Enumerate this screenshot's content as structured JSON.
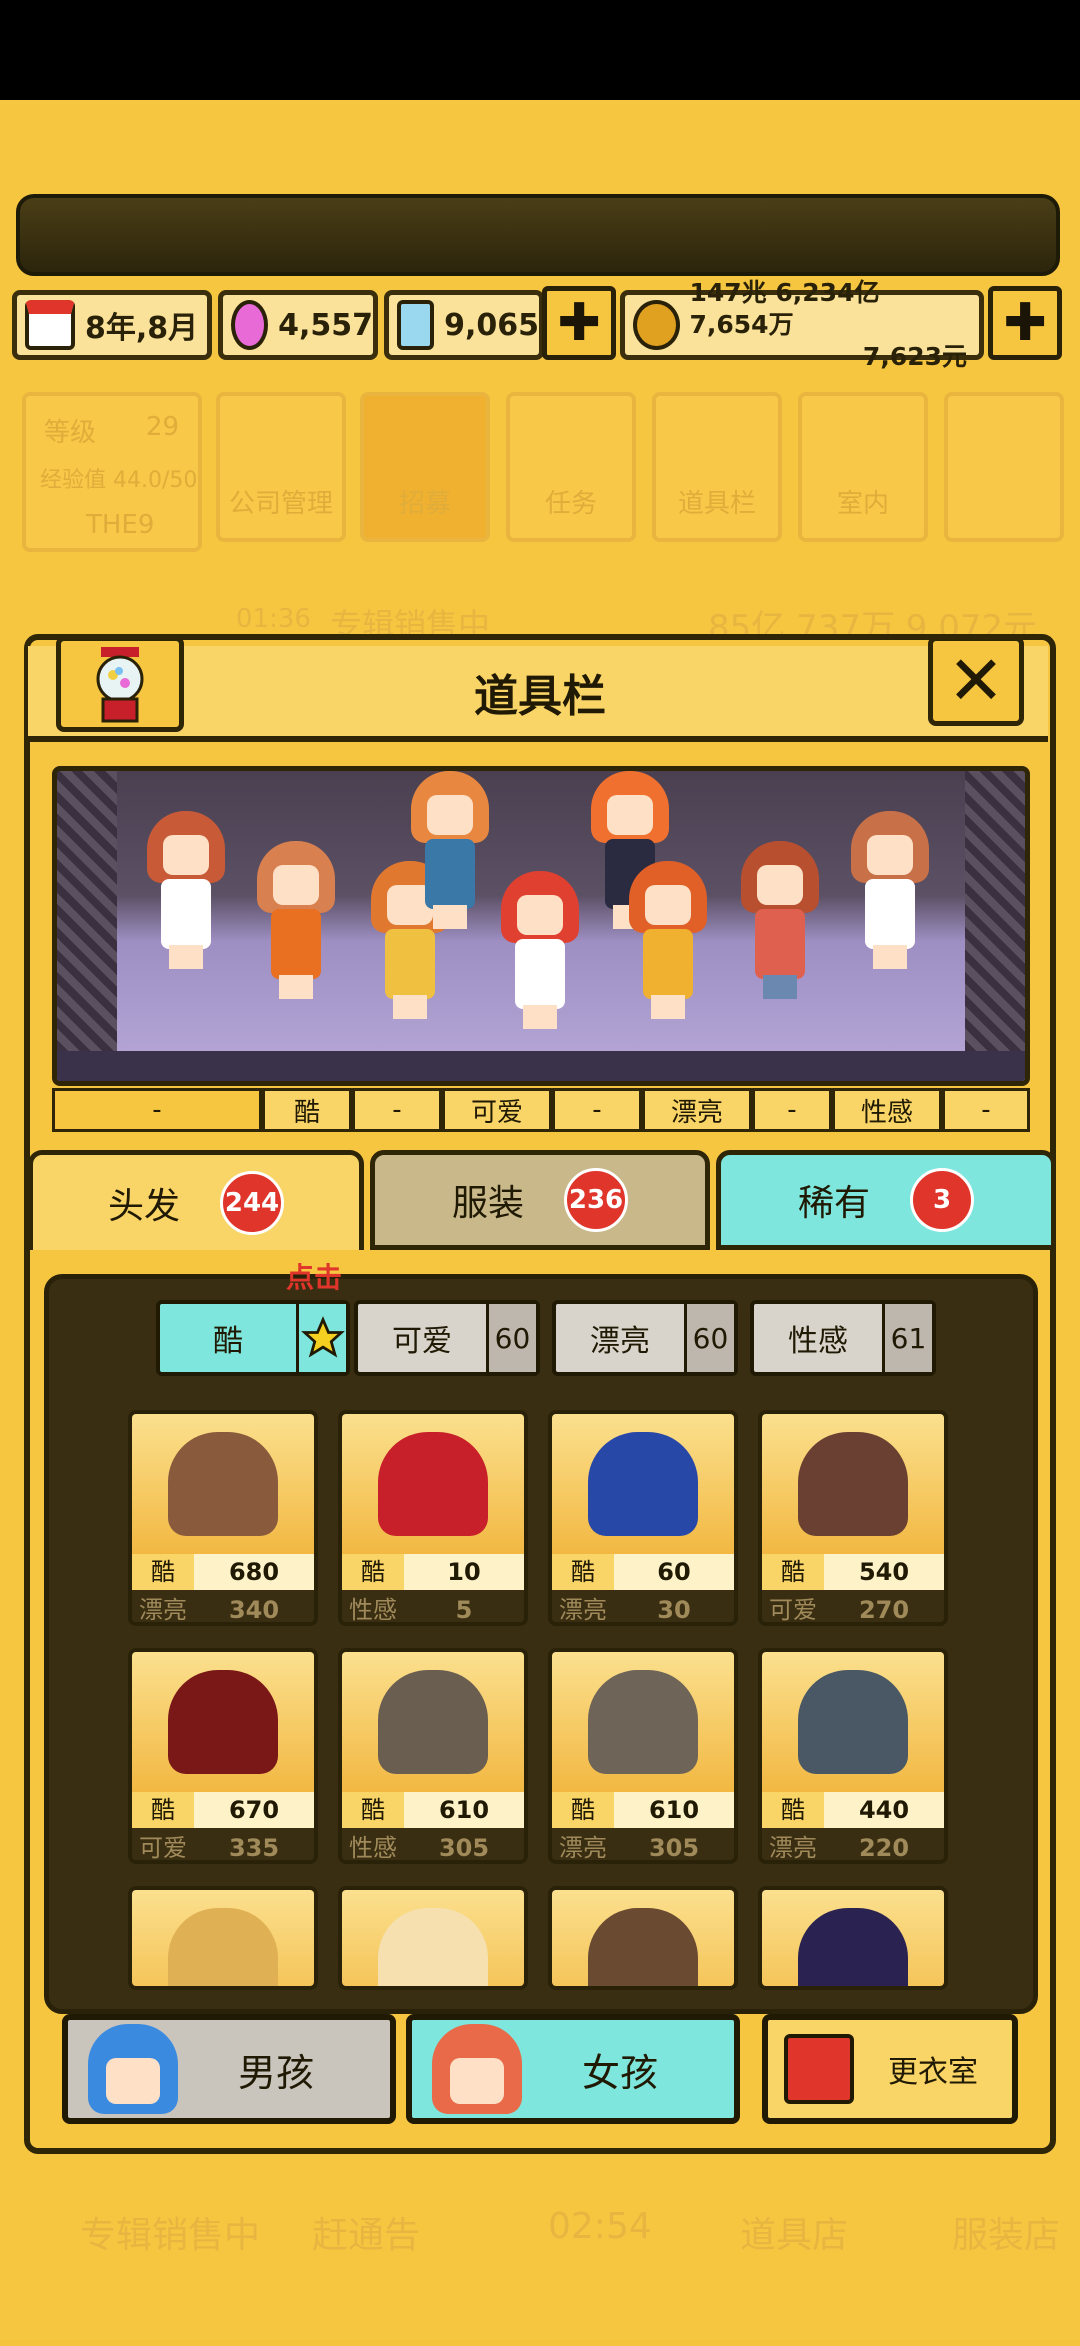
{
  "resources": {
    "date": "8年,8月",
    "gems_pink": "4,557",
    "gems_blue": "9,065",
    "money_line1": "147兆 6,234亿 7,654万",
    "money_line2": "7,623元"
  },
  "background_menu": {
    "level_label": "等级",
    "level_value": "29",
    "exp_label": "经验值 44.0/50",
    "group_name": "THE9",
    "items": [
      "公司管理",
      "招募",
      "任务",
      "道具栏",
      "室内"
    ],
    "album_timer": "01:36",
    "album_status": "专辑销售中",
    "album_income": "85亿 737万 9,072元"
  },
  "panel": {
    "title": "道具栏",
    "close_icon": "close-icon",
    "gacha_icon": "gacha-machine-icon"
  },
  "stats_strip": [
    {
      "key": "",
      "value": "-"
    },
    {
      "key": "酷",
      "value": "-"
    },
    {
      "key": "可爱",
      "value": "-"
    },
    {
      "key": "漂亮",
      "value": "-"
    },
    {
      "key": "性感",
      "value": "-"
    }
  ],
  "category_tabs": [
    {
      "label": "头发",
      "count": "244",
      "active": true
    },
    {
      "label": "服装",
      "count": "236",
      "active": false
    },
    {
      "label": "稀有",
      "count": "3",
      "active": false
    }
  ],
  "tap_hint": "点击",
  "filter_tabs": [
    {
      "label": "酷",
      "count": "",
      "active": true
    },
    {
      "label": "可爱",
      "count": "60",
      "active": false
    },
    {
      "label": "漂亮",
      "count": "60",
      "active": false
    },
    {
      "label": "性感",
      "count": "61",
      "active": false
    }
  ],
  "items": [
    {
      "stat1": "酷",
      "val1": "680",
      "stat2": "漂亮",
      "val2": "340",
      "color": "#8a5a3c"
    },
    {
      "stat1": "酷",
      "val1": "10",
      "stat2": "性感",
      "val2": "5",
      "color": "#c8202a"
    },
    {
      "stat1": "酷",
      "val1": "60",
      "stat2": "漂亮",
      "val2": "30",
      "color": "#2848a8"
    },
    {
      "stat1": "酷",
      "val1": "540",
      "stat2": "可爱",
      "val2": "270",
      "color": "#6a4032"
    },
    {
      "stat1": "酷",
      "val1": "670",
      "stat2": "可爱",
      "val2": "335",
      "color": "#7a1818"
    },
    {
      "stat1": "酷",
      "val1": "610",
      "stat2": "性感",
      "val2": "305",
      "color": "#6a5e50"
    },
    {
      "stat1": "酷",
      "val1": "610",
      "stat2": "漂亮",
      "val2": "305",
      "color": "#6e6458"
    },
    {
      "stat1": "酷",
      "val1": "440",
      "stat2": "漂亮",
      "val2": "220",
      "color": "#4a5866"
    },
    {
      "stat1": "",
      "val1": "",
      "stat2": "",
      "val2": "",
      "color": "#e0b054"
    },
    {
      "stat1": "",
      "val1": "",
      "stat2": "",
      "val2": "",
      "color": "#f6e0b0"
    },
    {
      "stat1": "",
      "val1": "",
      "stat2": "",
      "val2": "",
      "color": "#6a4a30"
    },
    {
      "stat1": "",
      "val1": "",
      "stat2": "",
      "val2": "",
      "color": "#2a2250"
    }
  ],
  "bottom_buttons": {
    "boy": "男孩",
    "girl": "女孩",
    "wardrobe": "更衣室"
  },
  "bottom_menu": [
    "专辑销售中",
    "赶通告",
    "02:54",
    "道具店",
    "服装店"
  ],
  "colors": {
    "bg": "#f7c641",
    "dark": "#2f2608",
    "accent_teal": "#7ee6dc",
    "badge_red": "#e0352a"
  }
}
